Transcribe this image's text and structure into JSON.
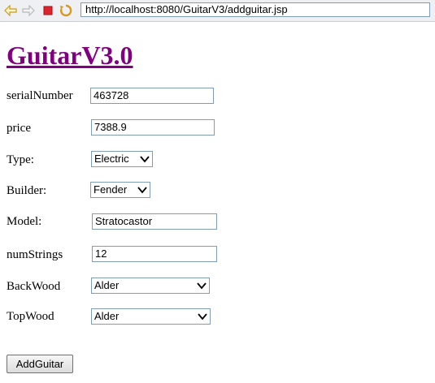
{
  "browser": {
    "url": "http://localhost:8080/GuitarV3/addguitar.jsp",
    "icons": [
      "back-arrow-icon",
      "forward-arrow-icon",
      "stop-icon",
      "refresh-icon"
    ]
  },
  "page": {
    "title": "GuitarV3.0",
    "title_color": "#800080"
  },
  "form": {
    "serialNumber": {
      "label": "serialNumber",
      "value": "463728"
    },
    "price": {
      "label": "price",
      "value": "7388.9"
    },
    "type": {
      "label": "Type:",
      "value": "Electric"
    },
    "builder": {
      "label": "Builder:",
      "value": "Fender"
    },
    "model": {
      "label": "Model:",
      "value": "Stratocastor"
    },
    "numStrings": {
      "label": "numStrings",
      "value": "12"
    },
    "backWood": {
      "label": "BackWood",
      "value": "Alder"
    },
    "topWood": {
      "label": "TopWood",
      "value": "Alder"
    },
    "submit_label": "AddGuitar"
  }
}
